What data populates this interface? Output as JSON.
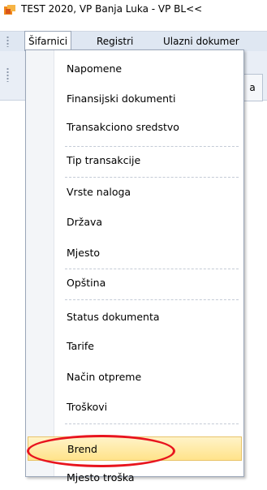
{
  "window": {
    "title": "TEST 2020, VP Banja Luka - VP BL<<"
  },
  "menubar": {
    "items": [
      "Šifarnici",
      "Registri",
      "Ulazni dokumer"
    ]
  },
  "toolbar": {
    "partial_label": "a"
  },
  "dropdown": {
    "items": [
      "Napomene",
      "Finansijski dokumenti",
      "Transakciono sredstvo",
      "Tip transakcije",
      "Vrste naloga",
      "Država",
      "Mjesto",
      "Opština",
      "Status dokumenta",
      "Tarife",
      "Način otpreme",
      "Troškovi",
      "Brend",
      "Mjesto troška"
    ],
    "highlighted": "Brend"
  },
  "colors": {
    "highlight": "#ffe38a",
    "annotation": "#e8141e"
  }
}
